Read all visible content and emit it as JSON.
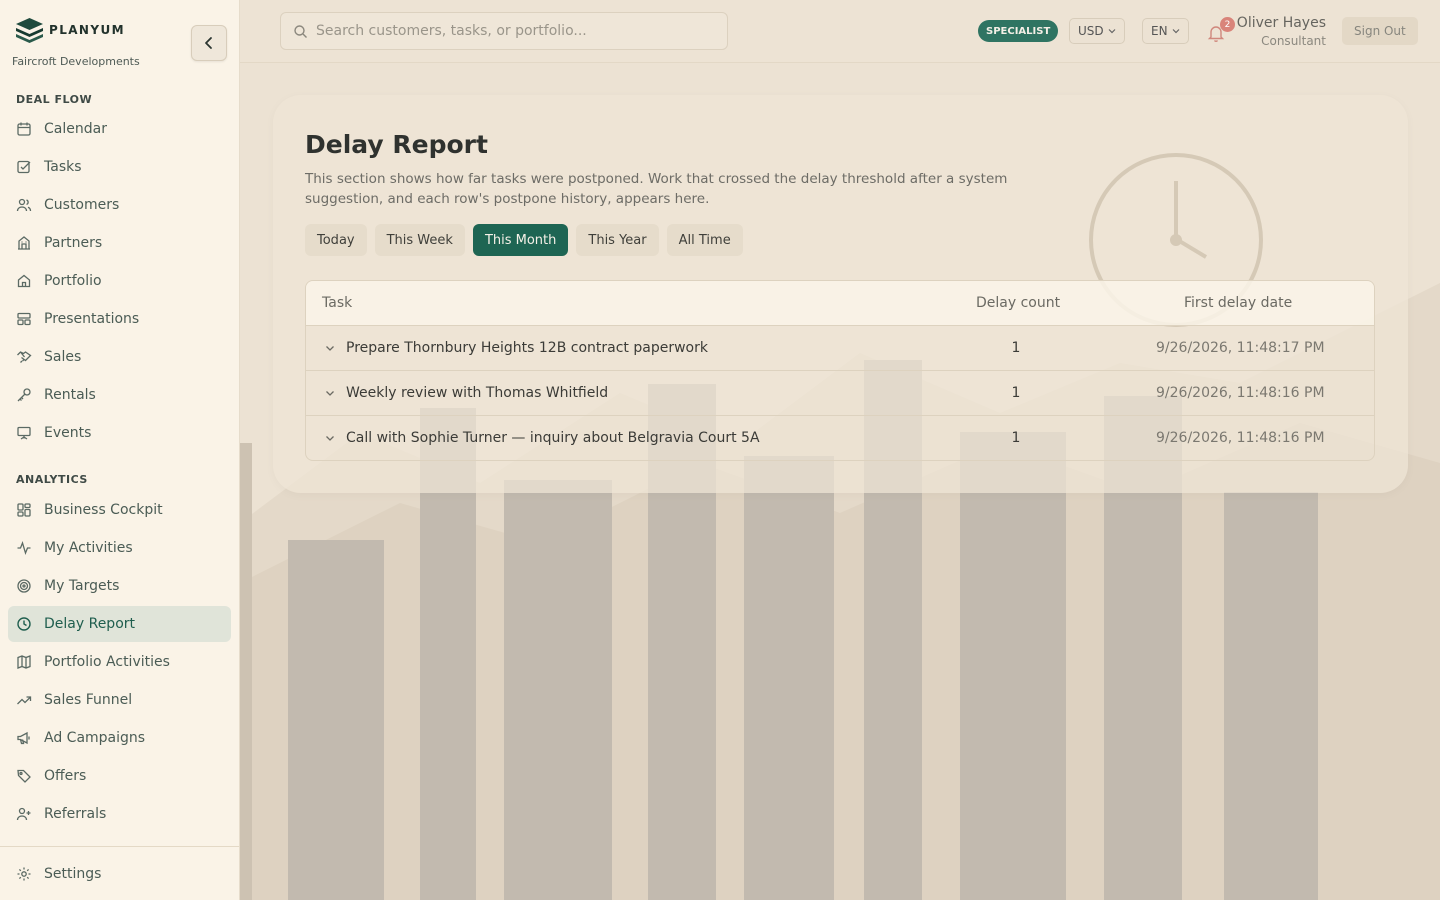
{
  "brand": {
    "name": "PLANYUM",
    "company": "Faircroft Developments"
  },
  "sidebar": {
    "sections": [
      {
        "label": "DEAL FLOW"
      },
      {
        "label": "ANALYTICS"
      }
    ],
    "deal_flow": [
      {
        "label": "Calendar",
        "icon": "calendar-icon"
      },
      {
        "label": "Tasks",
        "icon": "task-check-icon"
      },
      {
        "label": "Customers",
        "icon": "users-icon"
      },
      {
        "label": "Partners",
        "icon": "building-icon"
      },
      {
        "label": "Portfolio",
        "icon": "home-icon"
      },
      {
        "label": "Presentations",
        "icon": "layout-icon"
      },
      {
        "label": "Sales",
        "icon": "handshake-icon"
      },
      {
        "label": "Rentals",
        "icon": "key-icon"
      },
      {
        "label": "Events",
        "icon": "presentation-board-icon"
      }
    ],
    "analytics": [
      {
        "label": "Business Cockpit",
        "icon": "dashboard-icon"
      },
      {
        "label": "My Activities",
        "icon": "activity-icon"
      },
      {
        "label": "My Targets",
        "icon": "target-icon"
      },
      {
        "label": "Delay Report",
        "icon": "clock-icon",
        "active": true
      },
      {
        "label": "Portfolio Activities",
        "icon": "map-icon"
      },
      {
        "label": "Sales Funnel",
        "icon": "trending-up-icon"
      },
      {
        "label": "Ad Campaigns",
        "icon": "megaphone-icon"
      },
      {
        "label": "Offers",
        "icon": "tag-icon"
      },
      {
        "label": "Referrals",
        "icon": "user-plus-icon"
      }
    ],
    "settings": {
      "label": "Settings",
      "icon": "gear-icon"
    }
  },
  "topbar": {
    "search_placeholder": "Search customers, tasks, or portfolio...",
    "role_badge": "SPECIALIST",
    "currency": "USD",
    "language": "EN",
    "notification_count": "2",
    "user_name": "Oliver Hayes",
    "user_role": "Consultant",
    "sign_out": "Sign Out"
  },
  "report": {
    "title": "Delay Report",
    "description": "This section shows how far tasks were postponed. Work that crossed the delay threshold after a system suggestion, and each row's postpone history, appears here.",
    "filters": [
      "Today",
      "This Week",
      "This Month",
      "This Year",
      "All Time"
    ],
    "active_filter": "This Month",
    "columns": {
      "task": "Task",
      "count": "Delay count",
      "date": "First delay date"
    },
    "rows": [
      {
        "task": "Prepare Thornbury Heights 12B contract paperwork",
        "count": "1",
        "date": "9/26/2026, 11:48:17 PM"
      },
      {
        "task": "Weekly review with Thomas Whitfield",
        "count": "1",
        "date": "9/26/2026, 11:48:16 PM"
      },
      {
        "task": "Call with Sophie Turner — inquiry about Belgravia Court 5A",
        "count": "1",
        "date": "9/26/2026, 11:48:16 PM"
      }
    ]
  },
  "colors": {
    "accent": "#1e6553",
    "badge": "#2f7462",
    "notification": "#d9847a",
    "sidebar_bg": "#faf3e7",
    "page_bg": "#ece2d3"
  }
}
